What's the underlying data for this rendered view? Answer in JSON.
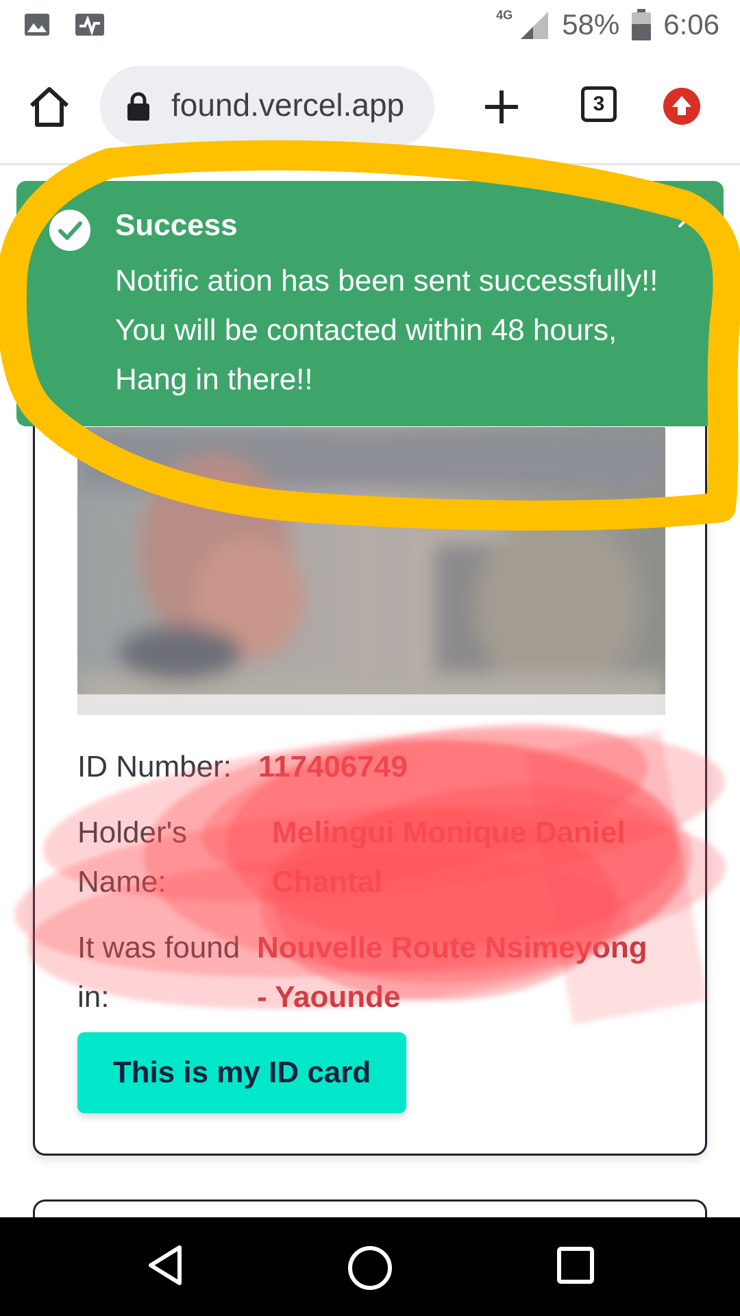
{
  "status_bar": {
    "network": "4G",
    "battery": "58%",
    "time": "6:06",
    "left_icons": [
      "image-icon",
      "activity-icon"
    ]
  },
  "browser": {
    "url": "found.vercel.app",
    "tab_count": "3",
    "icons": [
      "home-icon",
      "lock-icon",
      "plus-icon",
      "tab-switcher-icon",
      "update-icon"
    ]
  },
  "toast": {
    "title": "Success",
    "message": "Notific ation has been sent successfully!! You will be contacted within 48 hours, Hang in there!!",
    "color": "#3ea56a"
  },
  "card": {
    "id_label": "ID Number:",
    "id_value": "117406749",
    "holder_label": "Holder's Name:",
    "holder_value_line1": "Melingui Monique Daniel",
    "holder_value_line2": "Chantal",
    "location_label": "It was found in:",
    "location_value_line1": "Nouvelle Route Nsimeyong",
    "location_value_line2": "- Yaounde",
    "claim_button": "This is my ID card",
    "accent": "#00e8c9"
  },
  "colors": {
    "highlight": "#ffc000",
    "redaction": "#ff5a5f"
  }
}
